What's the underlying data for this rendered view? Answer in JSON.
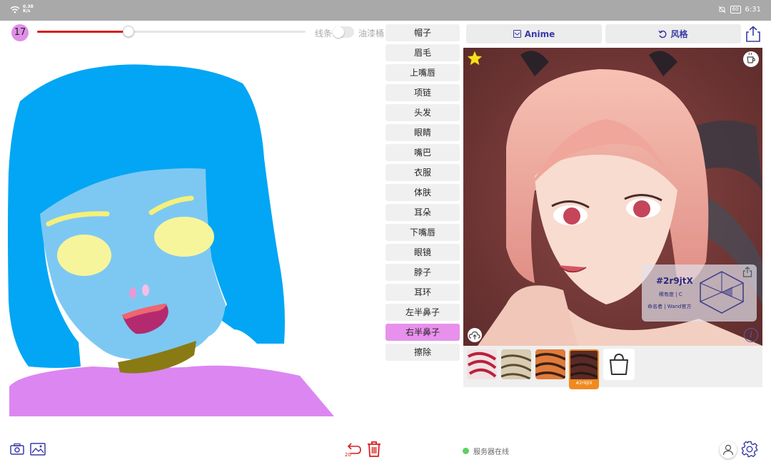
{
  "status": {
    "network_speed": "0.38",
    "network_unit": "K/s",
    "battery": "60",
    "time": "6:31"
  },
  "brush": {
    "size": "17",
    "slider_value_pct": 34
  },
  "modes": {
    "line": "线条",
    "bucket": "油漆桶"
  },
  "labels": [
    {
      "text": "帽子",
      "active": false
    },
    {
      "text": "眉毛",
      "active": false
    },
    {
      "text": "上嘴唇",
      "active": false
    },
    {
      "text": "项链",
      "active": false
    },
    {
      "text": "头发",
      "active": false
    },
    {
      "text": "眼睛",
      "active": false
    },
    {
      "text": "嘴巴",
      "active": false
    },
    {
      "text": "衣服",
      "active": false
    },
    {
      "text": "体肤",
      "active": false
    },
    {
      "text": "耳朵",
      "active": false
    },
    {
      "text": "下嘴唇",
      "active": false
    },
    {
      "text": "眼镜",
      "active": false
    },
    {
      "text": "脖子",
      "active": false
    },
    {
      "text": "耳环",
      "active": false
    },
    {
      "text": "左半鼻子",
      "active": false
    },
    {
      "text": "右半鼻子",
      "active": true
    },
    {
      "text": "擦除",
      "active": false
    }
  ],
  "tabs": {
    "anime": "Anime",
    "style": "风格"
  },
  "card": {
    "code": "#2r9jtX",
    "rarity": "稀有度 | C",
    "author": "命名者 | Wand官方"
  },
  "thumbnails": [
    {
      "name": "style-red",
      "caption": ""
    },
    {
      "name": "style-sketch",
      "caption": ""
    },
    {
      "name": "style-orange",
      "caption": ""
    },
    {
      "name": "style-selected",
      "caption": "#2r9jtX"
    }
  ],
  "undo": {
    "count": "20"
  },
  "server": {
    "status": "服务器在线"
  },
  "colors": {
    "accent": "#e891ec",
    "slider": "#d71d1d",
    "tab_text": "#3a3aa8",
    "online": "#5ed15e",
    "selected_thumb": "#f08a20"
  }
}
